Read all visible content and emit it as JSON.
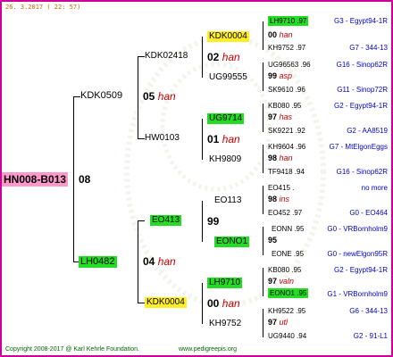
{
  "date": "26. 3.2017 ( 22: 57)",
  "footer_left": "Copyright 2008-2017 @ Karl Kehrle Foundation.",
  "footer_right": "www.pedigreepis.org",
  "root": {
    "ring": "HN008-B013",
    "year": "08"
  },
  "gen1": [
    {
      "ring": "KDK0509",
      "year": "05",
      "label": "han"
    },
    {
      "ring": "LH0482",
      "year": "04",
      "label": "han"
    }
  ],
  "gen2": [
    {
      "ring": "KDK02418",
      "year": "02",
      "label": "han"
    },
    {
      "ring": "HW0103",
      "year": "01",
      "label": "han"
    },
    {
      "ring": "EO413",
      "year": "99",
      "label": ""
    },
    {
      "ring": "KDK0004",
      "year": "00",
      "label": "han"
    }
  ],
  "gen3": [
    {
      "ring": "KDK0004"
    },
    {
      "ring": "UG99555"
    },
    {
      "ring": "UG9714"
    },
    {
      "ring": "KH9809"
    },
    {
      "ring": "EO113"
    },
    {
      "ring": "EONO1"
    },
    {
      "ring": "LH9710"
    },
    {
      "ring": "KH9752"
    }
  ],
  "gen3_info": [
    {
      "year": "00",
      "label": "han"
    },
    {
      "year": "99",
      "label": "asp"
    },
    {
      "year": "97",
      "label": "has"
    },
    {
      "year": "98",
      "label": "han"
    },
    {
      "year": "98",
      "label": "ins"
    },
    {
      "year": "95",
      "label": ""
    },
    {
      "year": "97",
      "label": "valn"
    },
    {
      "year": "97",
      "label": "utl"
    }
  ],
  "gen4": [
    {
      "left": "LH9710 .97",
      "right": "G3 - Egypt94-1R"
    },
    {
      "left": "KH9752 .97",
      "right": "G7 - 344-13"
    },
    {
      "left": "UG96563 .96",
      "right": "G16 - Sinop62R"
    },
    {
      "left": "SK9610 .96",
      "right": "G11 - Sinop72R"
    },
    {
      "left": "KB080 .95",
      "right": "G2 - Egypt94-1R"
    },
    {
      "left": "SK9221 .92",
      "right": "G2 - AA8519"
    },
    {
      "left": "KH9604 .96",
      "right": "G7 - MtElgonEggs"
    },
    {
      "left": "TF9418 .94",
      "right": "G16 - Sinop62R"
    },
    {
      "left": "EO415 .",
      "right": "no more"
    },
    {
      "left": "EO452 .97",
      "right": "G0 - EO464"
    },
    {
      "left": "EONN .95",
      "right": "G0 - VRBornholm9"
    },
    {
      "left": "EONE .95",
      "right": "G0 - newElgon95R"
    },
    {
      "left": "KB080 .95",
      "right": "G2 - Egypt94-1R"
    },
    {
      "left": "EONO1 .95",
      "right": "G1 - VRBornholm9"
    },
    {
      "left": "KH9522 .95",
      "right": "G6 - 344-13"
    },
    {
      "left": "UG9440 .94",
      "right": "G2 - 91-L1"
    }
  ]
}
